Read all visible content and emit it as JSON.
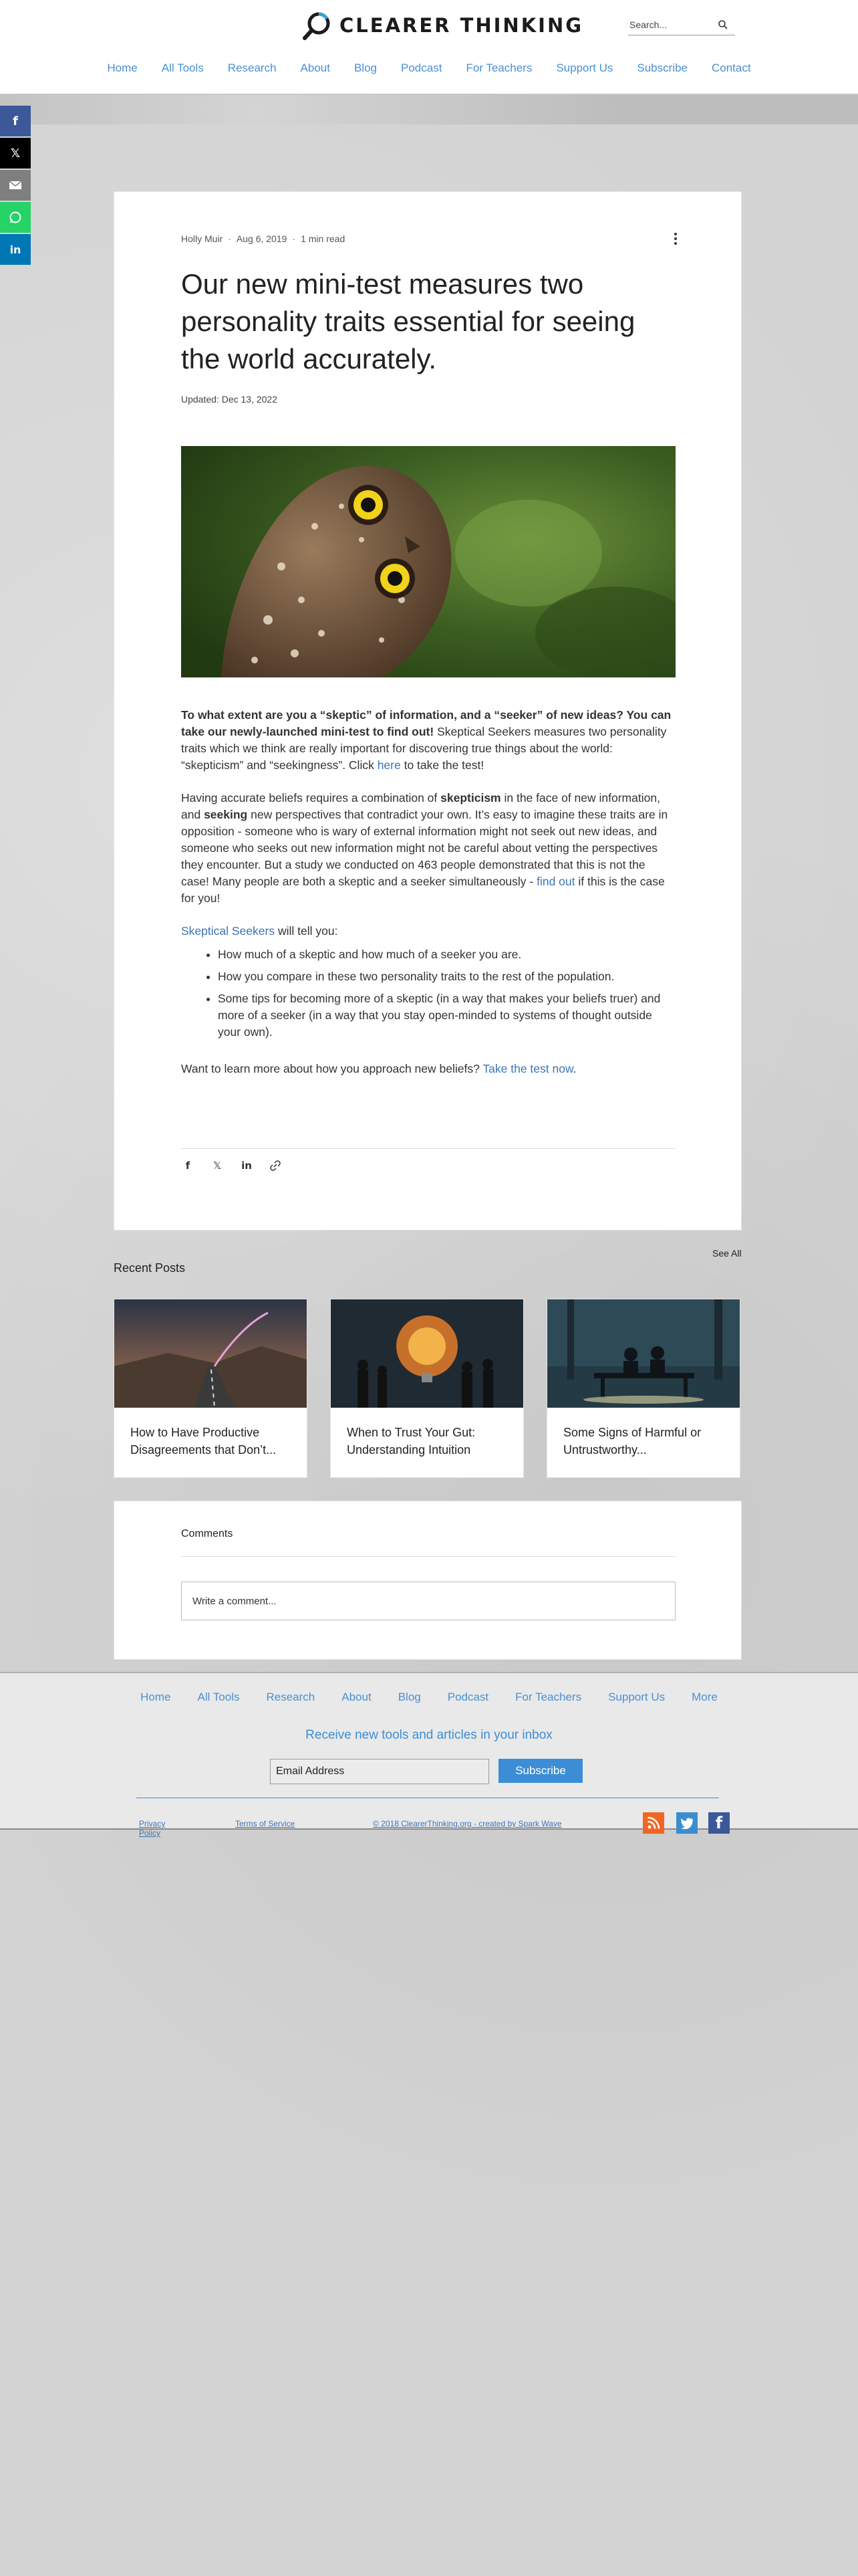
{
  "site": {
    "logo_text": "CLEARER THINKING",
    "search_placeholder": "Search..."
  },
  "nav": [
    "Home",
    "All Tools",
    "Research",
    "About",
    "Blog",
    "Podcast",
    "For Teachers",
    "Support Us",
    "Subscribe",
    "Contact"
  ],
  "share_sidebar": {
    "colors": {
      "facebook": "#3b5998",
      "x": "#000000",
      "email": "#7f7f7f",
      "whatsapp": "#25d366",
      "linkedin": "#0077b5"
    }
  },
  "post": {
    "author": "Holly Muir",
    "date": "Aug 6, 2019",
    "read_time": "1 min read",
    "title": "Our new mini-test measures two personality traits essential for seeing the world accurately.",
    "updated": "Updated: Dec 13, 2022",
    "p1_bold": "To what extent are you a “skeptic” of information, and a “seeker” of new ideas? You can take our newly-launched mini-test to find out!",
    "p1_text": " Skeptical Seekers measures two personality traits which we think are really important for discovering true things about the world: “skepticism” and “seekingness”. Click ",
    "p1_link": "here",
    "p1_end": " to take the test!",
    "p2_a": "Having accurate beliefs requires a combination of ",
    "p2_bold1": "skepticism",
    "p2_b": " in the face of new information, and ",
    "p2_bold2": "seeking",
    "p2_c": " new perspectives that contradict your own. It’s easy to imagine these traits are in opposition - someone who is wary of external information might not seek out new ideas, and someone who seeks out new information might not be careful about vetting the perspectives they encounter. But a study we conducted on 463 people demonstrated that this is not the case! Many people are both a skeptic and a seeker simultaneously - ",
    "p2_link": "find out",
    "p2_end": " if this is the case for you!",
    "p3_link": "Skeptical Seekers",
    "p3_text": " will tell you:",
    "bullets": [
      "How much of a skeptic and how much of a seeker you are.",
      "How you compare in these two personality traits to the rest of the population.",
      "Some tips for becoming more of a skeptic (in a way that makes your beliefs truer) and more of a seeker (in a way that you stay open-minded to systems of thought outside your own)."
    ],
    "p4_text": "Want to learn more about how you approach new beliefs? ",
    "p4_link": "Take the test now",
    "p4_end": "."
  },
  "recent": {
    "title": "Recent Posts",
    "see_all": "See All",
    "posts": [
      {
        "title": "How to Have Productive Disagreements that Don’t..."
      },
      {
        "title": "When to Trust Your Gut: Understanding Intuition"
      },
      {
        "title": "Some Signs of Harmful or Untrustworthy..."
      }
    ]
  },
  "comments": {
    "title": "Comments",
    "placeholder": "Write a comment..."
  },
  "footer": {
    "nav": [
      "Home",
      "All Tools",
      "Research",
      "About",
      "Blog",
      "Podcast",
      "For Teachers",
      "Support Us",
      "More"
    ],
    "newsletter_title": "Receive new tools and articles in your inbox",
    "email_placeholder": "Email Address",
    "subscribe_label": "Subscribe",
    "privacy_line1": "Privacy",
    "privacy_line2": "Policy",
    "terms": "Terms of Service",
    "copyright": "© 2018 ClearerThinking.org - created by Spark Wave",
    "social_colors": {
      "rss": "#f26522",
      "twitter": "#3a8dd0",
      "facebook": "#3b5998"
    }
  }
}
